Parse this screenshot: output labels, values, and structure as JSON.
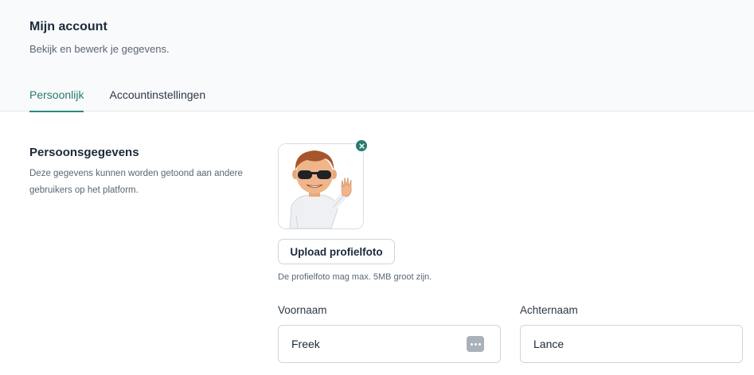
{
  "header": {
    "title": "Mijn account",
    "subtitle": "Bekijk en bewerk je gegevens."
  },
  "tabs": [
    {
      "label": "Persoonlijk",
      "active": true
    },
    {
      "label": "Accountinstellingen",
      "active": false
    }
  ],
  "section": {
    "title": "Persoonsgegevens",
    "description": "Deze gegevens kunnen worden getoond aan andere gebruikers op het platform."
  },
  "profile_photo": {
    "remove_icon": "close-icon",
    "upload_label": "Upload profielfoto",
    "hint": "De profielfoto mag max. 5MB groot zijn."
  },
  "fields": {
    "first_name": {
      "label": "Voornaam",
      "value": "Freek",
      "icon": "password-manager-icon"
    },
    "last_name": {
      "label": "Achternaam",
      "value": "Lance"
    }
  },
  "colors": {
    "accent": "#2a7a6f",
    "text": "#1b2a3a",
    "muted": "#5a6675",
    "border": "#cfd5dc"
  }
}
